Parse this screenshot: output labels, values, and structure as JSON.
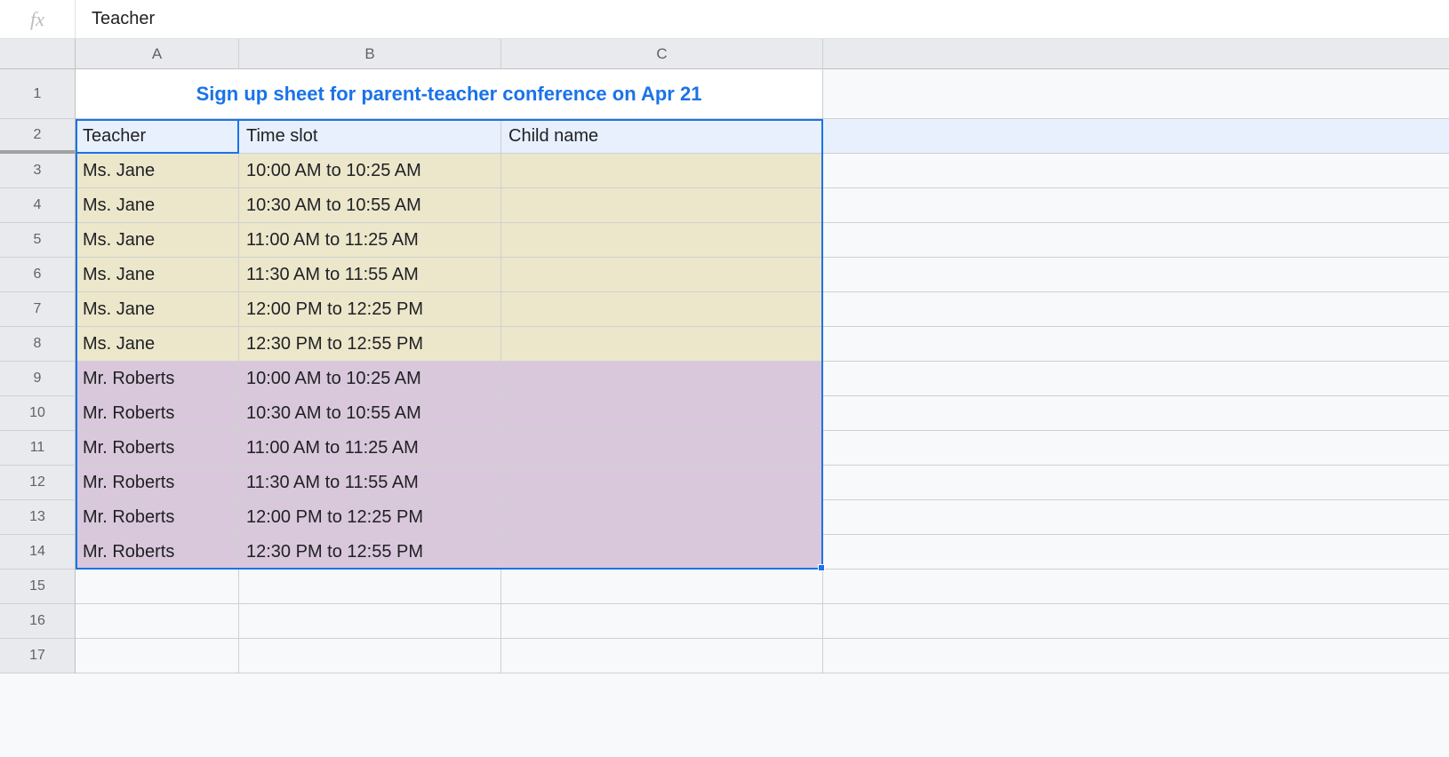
{
  "formula_bar": {
    "fx_label": "fx",
    "value": "Teacher"
  },
  "columns": [
    "A",
    "B",
    "C"
  ],
  "row_numbers": [
    1,
    2,
    3,
    4,
    5,
    6,
    7,
    8,
    9,
    10,
    11,
    12,
    13,
    14,
    15,
    16,
    17
  ],
  "title": "Sign up sheet for parent-teacher conference on Apr 21",
  "headers": {
    "teacher": "Teacher",
    "time_slot": "Time slot",
    "child_name": "Child name"
  },
  "rows": [
    {
      "teacher": "Ms. Jane",
      "time": "10:00 AM to 10:25 AM",
      "child": "",
      "group": "beige"
    },
    {
      "teacher": "Ms. Jane",
      "time": "10:30 AM to 10:55 AM",
      "child": "",
      "group": "beige"
    },
    {
      "teacher": "Ms. Jane",
      "time": "11:00 AM to 11:25 AM",
      "child": "",
      "group": "beige"
    },
    {
      "teacher": "Ms. Jane",
      "time": "11:30 AM to 11:55 AM",
      "child": "",
      "group": "beige"
    },
    {
      "teacher": "Ms. Jane",
      "time": "12:00 PM to 12:25 PM",
      "child": "",
      "group": "beige"
    },
    {
      "teacher": "Ms. Jane",
      "time": "12:30 PM to 12:55 PM",
      "child": "",
      "group": "beige"
    },
    {
      "teacher": "Mr. Roberts",
      "time": "10:00 AM to 10:25 AM",
      "child": "",
      "group": "purple"
    },
    {
      "teacher": "Mr. Roberts",
      "time": "10:30 AM to 10:55 AM",
      "child": "",
      "group": "purple"
    },
    {
      "teacher": "Mr. Roberts",
      "time": "11:00 AM to 11:25 AM",
      "child": "",
      "group": "purple"
    },
    {
      "teacher": "Mr. Roberts",
      "time": "11:30 AM to 11:55 AM",
      "child": "",
      "group": "purple"
    },
    {
      "teacher": "Mr. Roberts",
      "time": "12:00 PM to 12:25 PM",
      "child": "",
      "group": "purple"
    },
    {
      "teacher": "Mr. Roberts",
      "time": "12:30 PM to 12:55 PM",
      "child": "",
      "group": "purple"
    }
  ],
  "colors": {
    "accent": "#1a73e8",
    "beige": "#ece7cb",
    "purple": "#d9c8db",
    "header_bg": "#e8f0fe"
  }
}
